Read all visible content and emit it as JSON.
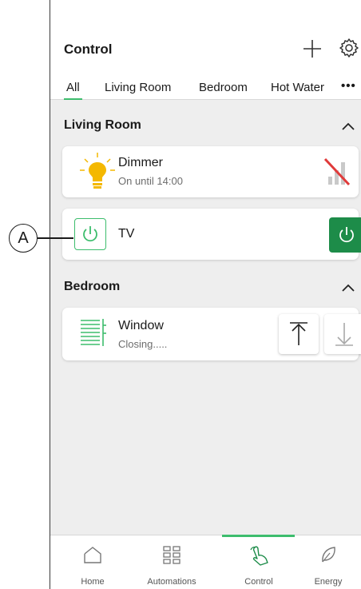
{
  "header": {
    "title": "Control",
    "tabs": [
      {
        "label": "All",
        "active": true
      },
      {
        "label": "Living Room",
        "active": false
      },
      {
        "label": "Bedroom",
        "active": false
      },
      {
        "label": "Hot Water",
        "active": false
      }
    ],
    "more_label": "•••",
    "add_icon": "plus-icon",
    "settings_icon": "gear-icon"
  },
  "sections": [
    {
      "title": "Living Room",
      "devices": [
        {
          "name": "Dimmer",
          "status": "On until 14:00",
          "icon": "lightbulb-icon",
          "action_icon": "signal-off-icon"
        },
        {
          "name": "TV",
          "icon": "power-icon",
          "action_icon": "power-icon"
        }
      ]
    },
    {
      "title": "Bedroom",
      "devices": [
        {
          "name": "Window",
          "status": "Closing.....",
          "icon": "blinds-icon",
          "actions": [
            "open-up-icon",
            "close-down-icon"
          ]
        }
      ]
    }
  ],
  "callout": {
    "label": "A"
  },
  "bottom_nav": [
    {
      "label": "Home",
      "icon": "home-icon",
      "active": false
    },
    {
      "label": "Automations",
      "icon": "grid-icon",
      "active": false
    },
    {
      "label": "Control",
      "icon": "hand-pointer-icon",
      "active": true
    },
    {
      "label": "Energy",
      "icon": "leaf-icon",
      "active": false
    }
  ],
  "colors": {
    "accent": "#3dbd6d",
    "power_button": "#1d8c49",
    "bulb": "#f4b800",
    "disabled_red": "#e03a3a"
  }
}
